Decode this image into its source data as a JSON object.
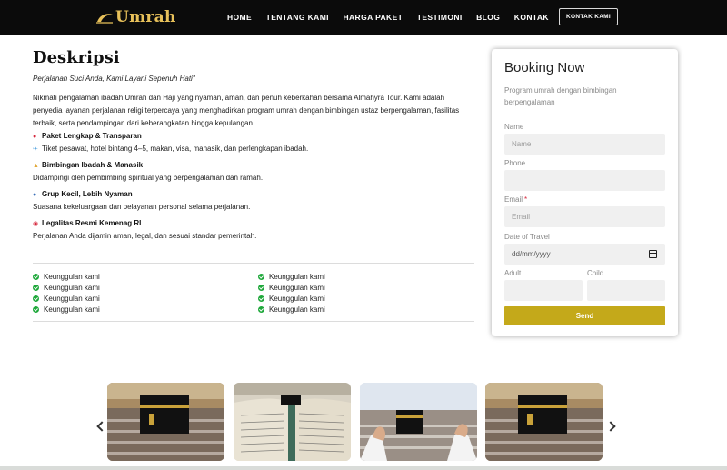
{
  "navbar": {
    "brand": "Umrah",
    "links": [
      "HOME",
      "TENTANG KAMI",
      "HARGA PAKET",
      "TESTIMONI",
      "BLOG",
      "KONTAK"
    ],
    "cta": "KONTAK KAMI"
  },
  "description": {
    "title": "Deskripsi",
    "tagline": "Perjalanan Suci Anda, Kami Layani Sepenuh Hati\"",
    "intro": "Nikmati pengalaman ibadah Umrah dan Haji yang nyaman, aman, dan penuh keberkahan bersama Almahyra Tour. Kami adalah penyedia layanan perjalanan religi terpercaya yang menghadirkan program umrah dengan bimbingan ustaz berpengalaman, fasilitas terbaik, serta pendampingan dari keberangkatan hingga kepulangan.",
    "features": [
      {
        "icon": "pin-icon",
        "title": "Paket Lengkap & Transparan",
        "desc_icon": "airplane-icon",
        "desc": "Tiket pesawat, hotel bintang 4–5, makan, visa, manasik, dan perlengkapan ibadah."
      },
      {
        "icon": "prayer-icon",
        "title": "Bimbingan Ibadah & Manasik",
        "desc": "Didampingi oleh pembimbing spiritual yang berpengalaman dan ramah."
      },
      {
        "icon": "group-icon",
        "title": "Grup Kecil, Lebih Nyaman",
        "desc": "Suasana kekeluargaan dan pelayanan personal selama perjalanan."
      },
      {
        "icon": "target-icon",
        "title": "Legalitas Resmi Kemenag RI",
        "desc": "Perjalanan Anda dijamin aman, legal, dan sesuai standar pemerintah."
      }
    ],
    "advantages_left": [
      "Keunggulan kami",
      "Keunggulan kami",
      "Keunggulan kami",
      "Keunggulan kami"
    ],
    "advantages_right": [
      "Keunggulan kami",
      "Keunggulan kami",
      "Keunggulan kami",
      "Keunggulan kami"
    ]
  },
  "booking": {
    "title": "Booking Now",
    "subtitle": "Program umrah dengan bimbingan berpengalaman",
    "name_label": "Name",
    "name_placeholder": "Name",
    "phone_label": "Phone",
    "email_label": "Email",
    "email_required": "*",
    "email_placeholder": "Email",
    "date_label": "Date of Travel",
    "date_placeholder": "dd/mm/yyyy",
    "adult_label": "Adult",
    "child_label": "Child",
    "send_label": "Send",
    "accent_color": "#c4a91a"
  },
  "gallery": {
    "slides": [
      "kaaba-crowd-image",
      "quran-image",
      "praying-hands-kaaba-image",
      "kaaba-crowd-image"
    ]
  },
  "icons": {
    "check": "check-circle-icon",
    "check_color": "#1fa83b",
    "prev": "chevron-left-icon",
    "next": "chevron-right-icon"
  }
}
